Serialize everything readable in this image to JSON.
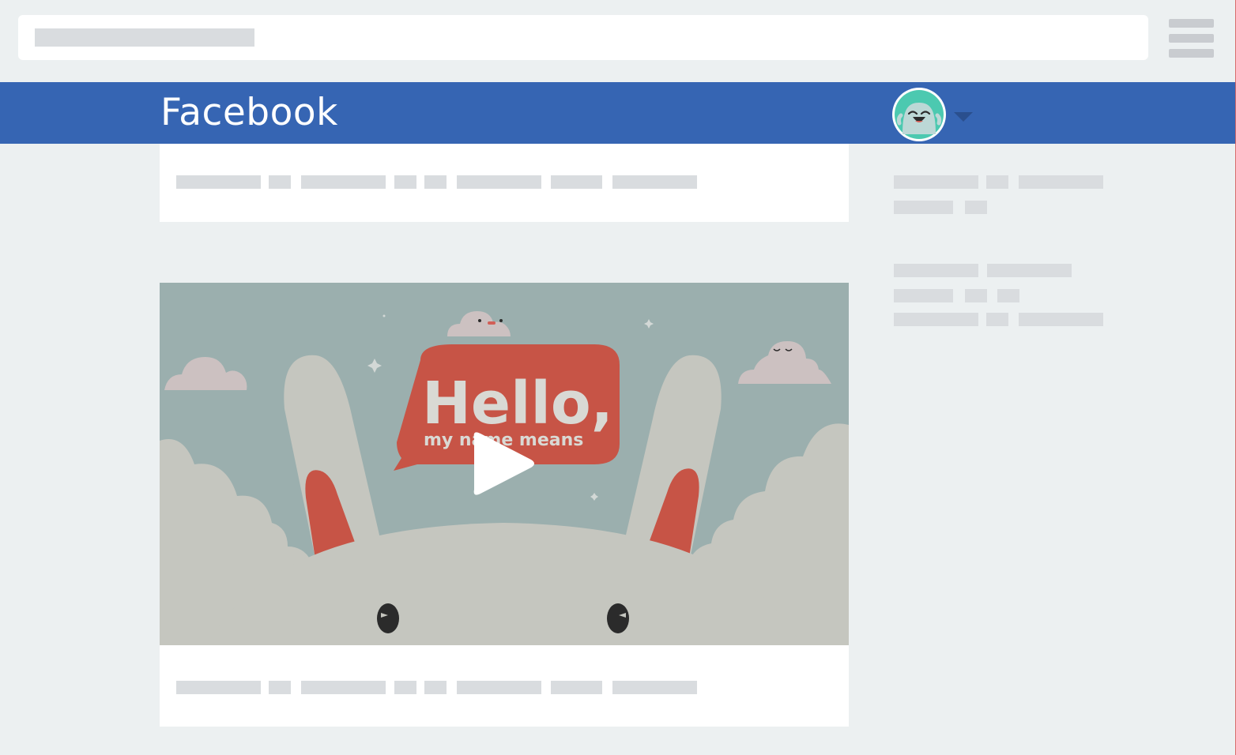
{
  "header": {
    "title": "Facebook",
    "brand_color": "#3665b3"
  },
  "browser": {
    "menu_icon": "hamburger-icon"
  },
  "profile": {
    "avatar_icon": "avatar-icon",
    "dropdown_icon": "caret-down-icon"
  },
  "video": {
    "headline": "Hello,",
    "subline": "my name means",
    "play_icon": "play-icon",
    "bubble_color": "#c75446",
    "sky_color": "#9bafae"
  }
}
